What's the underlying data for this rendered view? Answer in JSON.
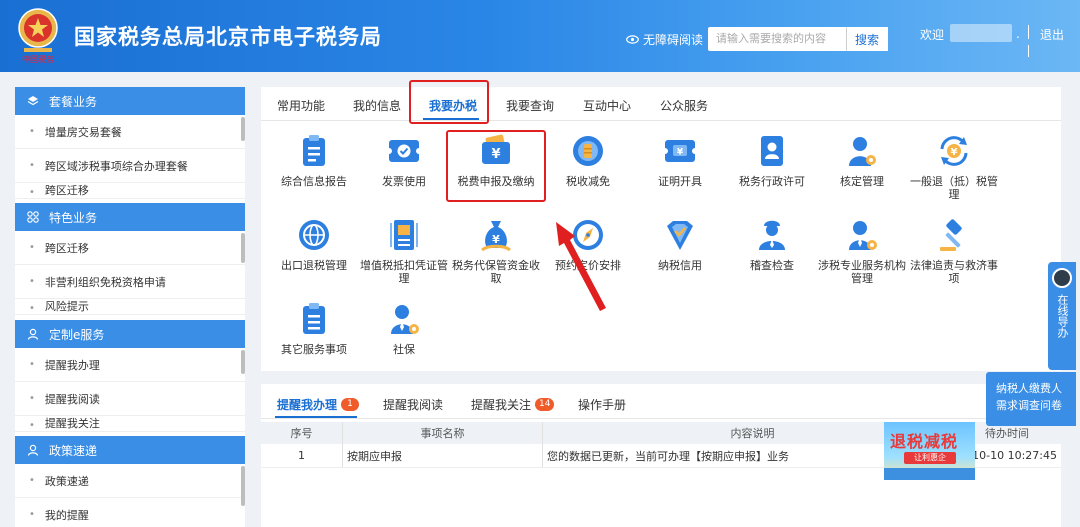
{
  "header": {
    "title": "国家税务总局北京市电子税务局",
    "accessibility": "无障碍阅读",
    "search_placeholder": "请输入需要搜索的内容",
    "search_button": "搜索",
    "welcome": "欢迎",
    "dot": ".",
    "logout": "退出"
  },
  "sidebar": {
    "sections": [
      {
        "title": "套餐业务",
        "icon": "layers-icon",
        "items": [
          "增量房交易套餐",
          "跨区域涉税事项综合办理套餐",
          "跨区迁移"
        ]
      },
      {
        "title": "特色业务",
        "icon": "grid-icon",
        "items": [
          "跨区迁移",
          "非营利组织免税资格申请",
          "风险提示"
        ]
      },
      {
        "title": "定制e服务",
        "icon": "user-icon",
        "items": [
          "提醒我办理",
          "提醒我阅读",
          "提醒我关注"
        ]
      },
      {
        "title": "政策速递",
        "icon": "user-icon",
        "items": [
          "政策速递",
          "我的提醒"
        ]
      }
    ]
  },
  "main": {
    "tabs": [
      "常用功能",
      "我的信息",
      "我要办税",
      "我要查询",
      "互动中心",
      "公众服务"
    ],
    "active_tab": "我要办税",
    "services": [
      {
        "label": "综合信息报告",
        "icon": "document-list-icon"
      },
      {
        "label": "发票使用",
        "icon": "invoice-icon"
      },
      {
        "label": "税费申报及缴纳",
        "icon": "wallet-icon"
      },
      {
        "label": "税收减免",
        "icon": "coin-stack-icon"
      },
      {
        "label": "证明开具",
        "icon": "certificate-icon"
      },
      {
        "label": "税务行政许可",
        "icon": "id-card-icon"
      },
      {
        "label": "核定管理",
        "icon": "person-gear-icon"
      },
      {
        "label": "一般退（抵）税管理",
        "icon": "refund-icon"
      },
      {
        "label": "出口退税管理",
        "icon": "globe-icon"
      },
      {
        "label": "增值税抵扣凭证管理",
        "icon": "ticket-icon"
      },
      {
        "label": "税务代保管资金收取",
        "icon": "money-bag-icon"
      },
      {
        "label": "预约定价安排",
        "icon": "compass-icon"
      },
      {
        "label": "纳税信用",
        "icon": "shield-check-icon"
      },
      {
        "label": "稽查检查",
        "icon": "inspector-icon"
      },
      {
        "label": "涉税专业服务机构管理",
        "icon": "agent-gear-icon"
      },
      {
        "label": "法律追责与救济事项",
        "icon": "gavel-icon"
      },
      {
        "label": "其它服务事项",
        "icon": "list-icon"
      },
      {
        "label": "社保",
        "icon": "social-security-icon"
      }
    ]
  },
  "reminder": {
    "tabs": [
      {
        "label": "提醒我办理",
        "badge": "1"
      },
      {
        "label": "提醒我阅读",
        "badge": ""
      },
      {
        "label": "提醒我关注",
        "badge": "14"
      },
      {
        "label": "操作手册",
        "badge": ""
      }
    ],
    "columns": [
      "序号",
      "事项名称",
      "内容说明",
      "待办时间"
    ],
    "rows": [
      [
        "1",
        "按期应申报",
        "您的数据已更新，当前可办理【按期应申报】业务",
        "2-10-10 10:27:45"
      ]
    ]
  },
  "promo": {
    "title": "退税减税",
    "subtitle": "让利惠企"
  },
  "floaters": {
    "online": "在线导办",
    "survey_line1": "纳税人缴费人",
    "survey_line2": "需求调查问卷"
  },
  "colors": {
    "primary": "#1a6fd3",
    "sidebar_head": "#3a8ee6",
    "highlight": "#e02020",
    "badge": "#f05b2a"
  }
}
